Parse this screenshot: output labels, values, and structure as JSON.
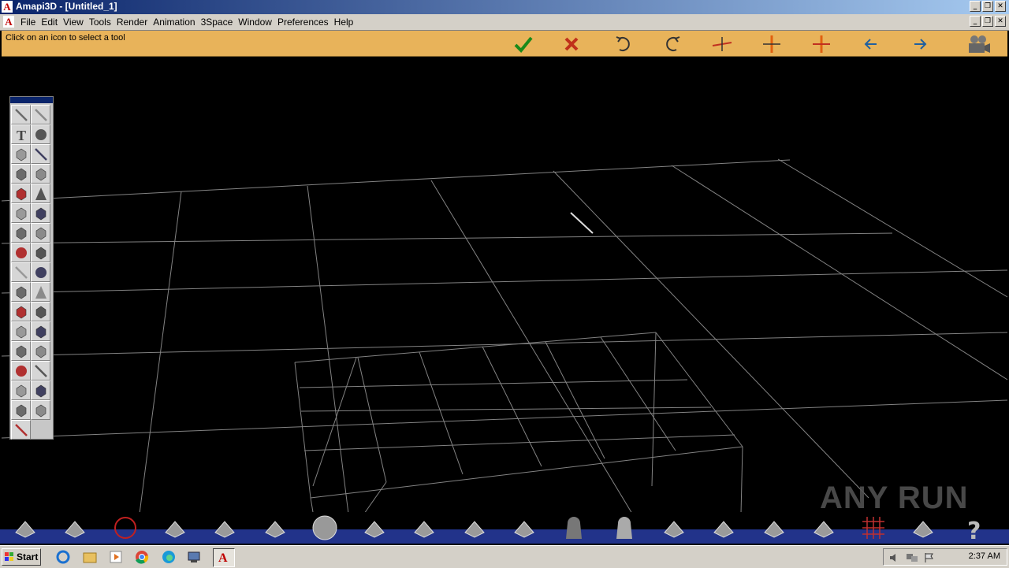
{
  "window": {
    "title": "Amapi3D - [Untitled_1]"
  },
  "menu": [
    "File",
    "Edit",
    "View",
    "Tools",
    "Render",
    "Animation",
    "3Space",
    "Window",
    "Preferences",
    "Help"
  ],
  "status": {
    "message": "Click on an icon to select a tool"
  },
  "toolbar_icons": [
    "check-icon",
    "cancel-icon",
    "undo-icon",
    "redo-icon",
    "axis-icon",
    "axis-vertical-icon",
    "axis-center-icon",
    "arrow-left-icon",
    "arrow-right-icon",
    "camera-icon"
  ],
  "palette_tools": [
    "line",
    "pen",
    "text",
    "sphere",
    "box",
    "pencil",
    "extrude",
    "cube-red",
    "curve",
    "cone",
    "sweep",
    "surface",
    "pipe",
    "lattice",
    "ball",
    "plane",
    "knife",
    "bulb",
    "bend",
    "triangle",
    "twist",
    "shape",
    "paint",
    "polycube",
    "arrow-right",
    "stack",
    "ring",
    "wand",
    "wireframe-box",
    "rotate",
    "down-arrow",
    "grid-plane",
    "magnet"
  ],
  "bottom_icons": [
    "layers",
    "cube-view",
    "globe",
    "plane-lamp",
    "terrain",
    "pen-tool",
    "sphere-render",
    "move-axes",
    "figure-grid",
    "figure-box",
    "eye",
    "ghost-dark",
    "ghost-light",
    "chain-link",
    "chain-break",
    "hammer",
    "triangle-ruler",
    "grid-red",
    "palette",
    "help"
  ],
  "watermark": "ANY RUN",
  "taskbar": {
    "start": "Start",
    "clock": "2:37 AM"
  }
}
